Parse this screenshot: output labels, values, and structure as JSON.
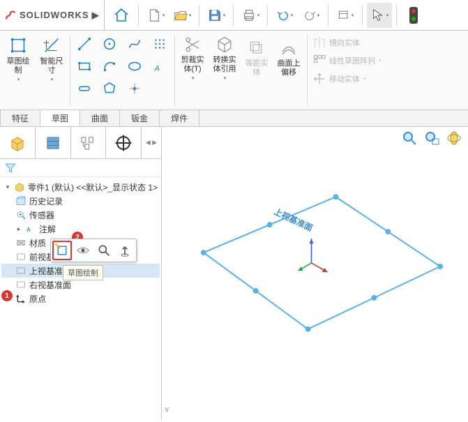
{
  "app": {
    "brand": "SOLIDWORKS"
  },
  "qat": {
    "search_dd": "▾"
  },
  "ribbon": {
    "sketch_btn": "草图绘\n制",
    "smartdim_btn": "智能尺\n寸",
    "trim": "剪裁实\n体(T)",
    "convert": "转换实\n体引用",
    "offset_e": "等距实\n体",
    "offset_s": "曲面上\n偏移",
    "mirror": "镜向实体",
    "pattern": "线性草图阵列",
    "move": "移动实体"
  },
  "doctabs": {
    "t1": "特征",
    "t2": "草图",
    "t3": "曲面",
    "t4": "钣金",
    "t5": "焊件"
  },
  "tree": {
    "root": "零件1 (默认) <<默认>_显示状态 1>",
    "history": "历史记录",
    "sensors": "传感器",
    "annotations": "注解",
    "material": "材质",
    "front": "前视基准面",
    "top": "上视基准面",
    "right": "右视基准面",
    "origin": "原点"
  },
  "context": {
    "tip": "草图绘制"
  },
  "callouts": {
    "c1": "1",
    "c2": "2"
  },
  "view": {
    "plane_label": "上视基准面",
    "axis_y": "Y"
  }
}
